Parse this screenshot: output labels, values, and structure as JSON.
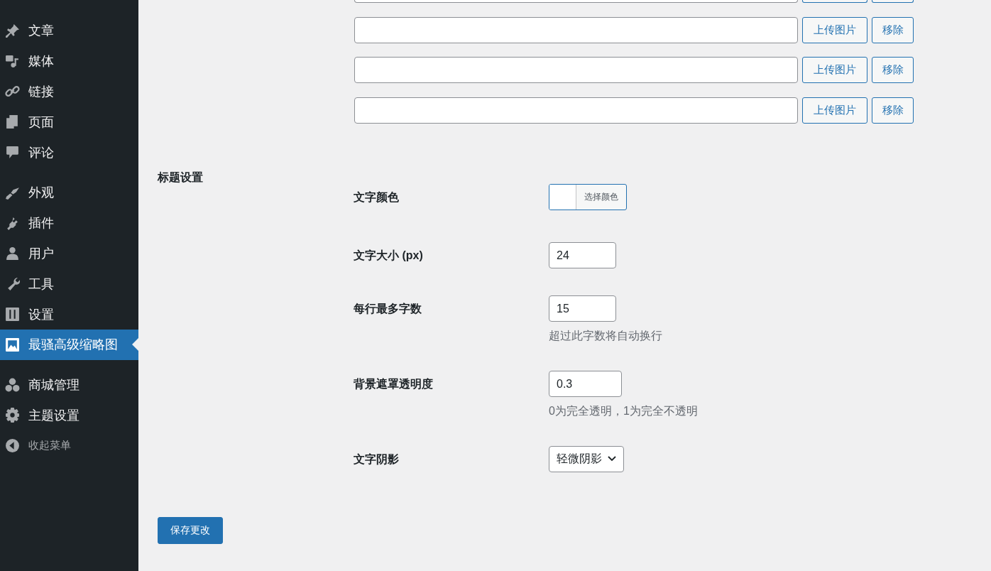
{
  "sidebar": {
    "groups": [
      [
        {
          "label": "文章",
          "selected": false
        },
        {
          "label": "媒体",
          "selected": false
        },
        {
          "label": "链接",
          "selected": false
        },
        {
          "label": "页面",
          "selected": false
        },
        {
          "label": "评论",
          "selected": false
        }
      ],
      [
        {
          "label": "外观",
          "selected": false
        },
        {
          "label": "插件",
          "selected": false
        },
        {
          "label": "用户",
          "selected": false
        },
        {
          "label": "工具",
          "selected": false
        },
        {
          "label": "设置",
          "selected": false
        },
        {
          "label": "最骚高级缩略图",
          "selected": true
        }
      ],
      [
        {
          "label": "商城管理",
          "selected": false
        },
        {
          "label": "主题设置",
          "selected": false
        }
      ]
    ],
    "collapse_menu": "收起菜单"
  },
  "image_rows": [
    {
      "upload_button": "上传图片",
      "remove_button": "移除"
    },
    {
      "upload_button": "上传图片",
      "remove_button": "移除"
    },
    {
      "upload_button": "上传图片",
      "remove_button": "移除"
    }
  ],
  "title_settings": {
    "heading": "标题设置",
    "fields": [
      {
        "kind": "color",
        "label": "文字颜色",
        "button": "选择颜色"
      },
      {
        "kind": "number",
        "label": "文字大小 (px)",
        "value": "24"
      },
      {
        "kind": "number",
        "label": "每行最多字数",
        "value": "15",
        "hint": "超过此字数将自动换行"
      },
      {
        "kind": "number",
        "label": "背景遮罩透明度",
        "value": "0.3",
        "hint": "0为完全透明，1为完全不透明"
      },
      {
        "kind": "select",
        "label": "文字阴影",
        "value": "轻微阴影"
      }
    ]
  },
  "save_button": "保存更改"
}
